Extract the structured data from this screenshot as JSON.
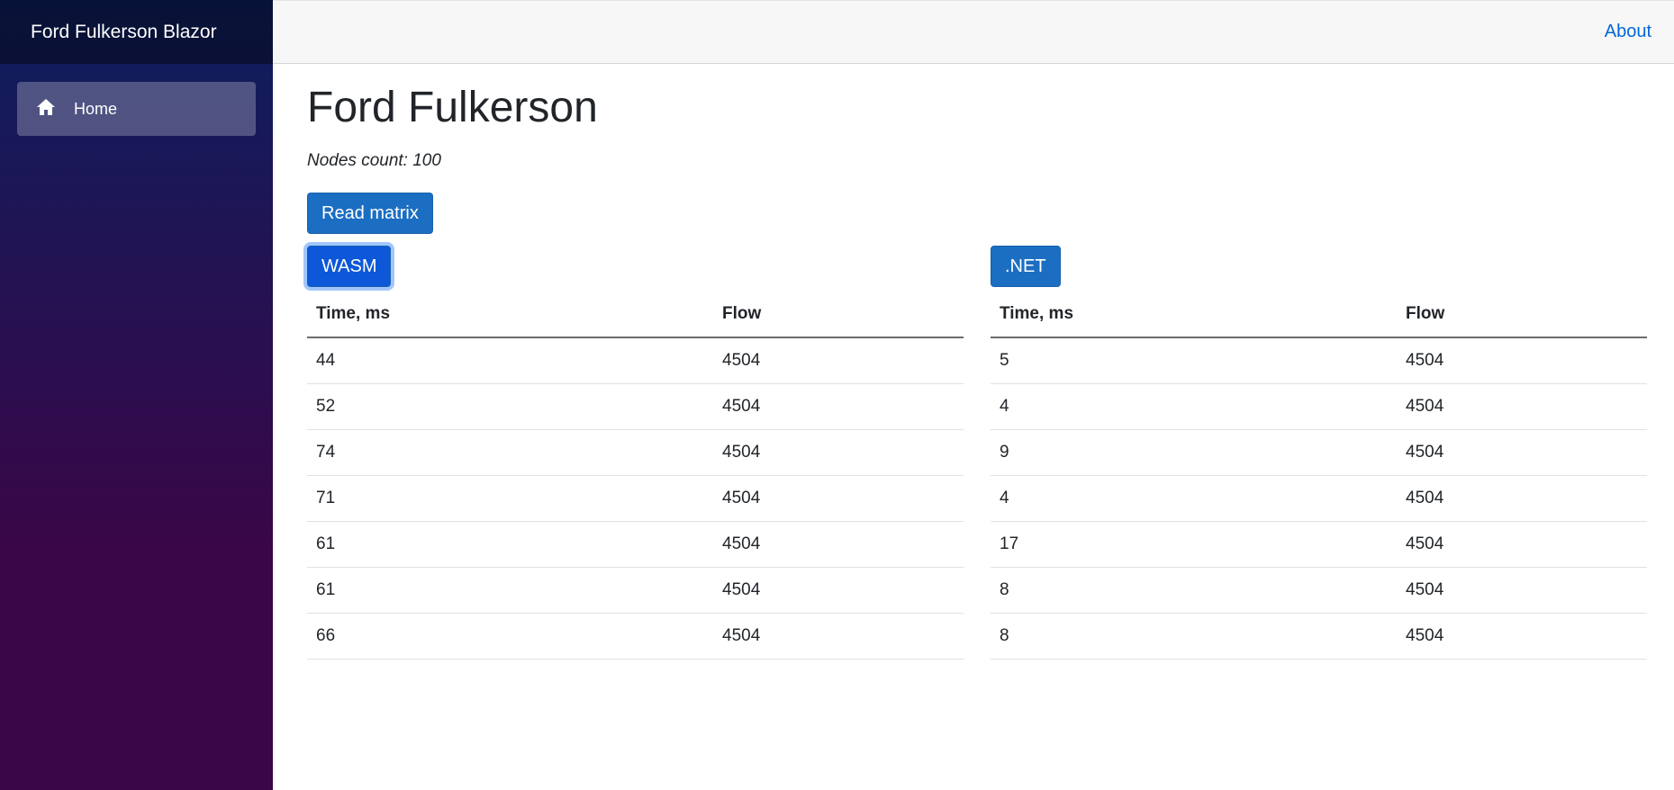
{
  "sidebar": {
    "brand": "Ford Fulkerson Blazor",
    "nav": [
      {
        "label": "Home",
        "icon": "home-icon"
      }
    ]
  },
  "topbar": {
    "about": "About"
  },
  "main": {
    "title": "Ford Fulkerson",
    "nodes_count": "Nodes count: 100",
    "read_button": "Read matrix",
    "wasm_button": "WASM",
    "net_button": ".NET",
    "wasm_table": {
      "headers": [
        "Time, ms",
        "Flow"
      ],
      "rows": [
        [
          "44",
          "4504"
        ],
        [
          "52",
          "4504"
        ],
        [
          "74",
          "4504"
        ],
        [
          "71",
          "4504"
        ],
        [
          "61",
          "4504"
        ],
        [
          "61",
          "4504"
        ],
        [
          "66",
          "4504"
        ]
      ]
    },
    "net_table": {
      "headers": [
        "Time, ms",
        "Flow"
      ],
      "rows": [
        [
          "5",
          "4504"
        ],
        [
          "4",
          "4504"
        ],
        [
          "9",
          "4504"
        ],
        [
          "4",
          "4504"
        ],
        [
          "17",
          "4504"
        ],
        [
          "8",
          "4504"
        ],
        [
          "8",
          "4504"
        ]
      ]
    }
  },
  "colors": {
    "button": "#1b6ec2",
    "link": "#0366d6",
    "sidebar_top": "#0d1f5e",
    "sidebar_bottom": "#3a0647"
  }
}
